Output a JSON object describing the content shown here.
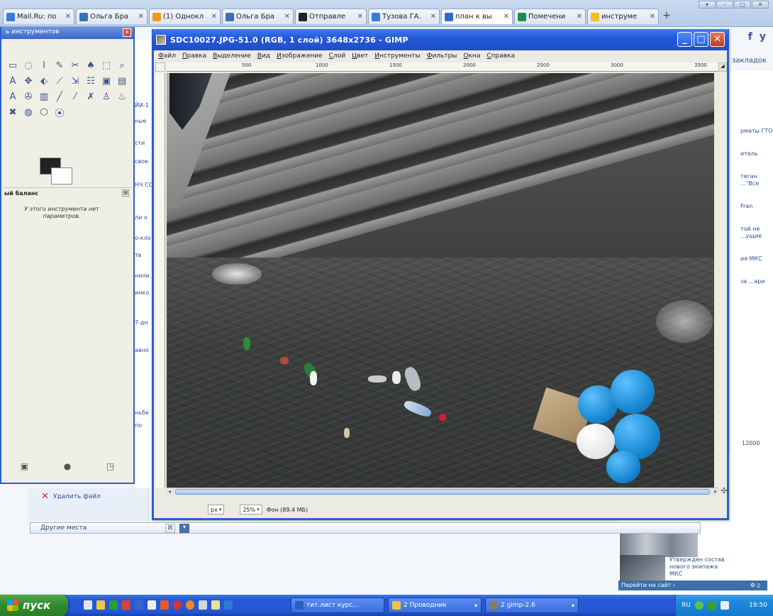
{
  "browser": {
    "tabs": [
      {
        "label": "Mail.Ru: по",
        "color": "#3a7ad8",
        "active": false
      },
      {
        "label": "Ольга Бра",
        "color": "#3b6fb6",
        "active": false
      },
      {
        "label": "(1) Однокл",
        "color": "#f29a1f",
        "active": false
      },
      {
        "label": "Ольга Бра",
        "color": "#3b6fb6",
        "active": false
      },
      {
        "label": "Отправле",
        "color": "#222222",
        "active": false
      },
      {
        "label": "Тузова ГА.",
        "color": "#3a7ad8",
        "active": false
      },
      {
        "label": "план к вы",
        "color": "#2f68c9",
        "active": true
      },
      {
        "label": "Помечени",
        "color": "#1e8f4a",
        "active": false
      },
      {
        "label": "инструме",
        "color": "#f2c01f",
        "active": false
      }
    ],
    "new_tab": "+",
    "window_controls": [
      "▾",
      "–",
      "□",
      "✕"
    ]
  },
  "background_page": {
    "social": [
      "f",
      "y"
    ],
    "bookmarks_link": "закладок",
    "right_snippets": [
      "рматы ГТО",
      "итель ",
      "теган ...\"Все",
      "Fran",
      "той не ...ущие",
      "ия МКС",
      "за ...ари"
    ],
    "right_number": "12000",
    "delete_file": "Удалить файл",
    "other_places": "Другие места",
    "widget_caption": "Утвержден состав нового экипажа МКС",
    "widget_bar": "Перейти на сайт ›",
    "mid_strip_items": [
      "ЙИ-1",
      "ные",
      "сти",
      "свое",
      "НЧ СС",
      "ли о",
      "о-кло",
      "тв",
      "нили",
      "инко",
      "7-дн",
      "авно",
      "ньбе",
      "по"
    ]
  },
  "toolbox": {
    "title": "ь инструментов",
    "close": "✕",
    "tools": [
      "▭",
      "◌",
      "⌇",
      "✎",
      "✂",
      "♠",
      "⬚",
      "⌕",
      "A",
      "✥",
      "⬖",
      "⟋",
      "⇲",
      "☷",
      "▣",
      "▤",
      "A",
      "✇",
      "▥",
      "╱",
      "⁄",
      "✗",
      "♙",
      "♨",
      "✖",
      "◍",
      "⬡",
      "⦿"
    ],
    "options_title": "ый баланс",
    "options_expand": "⊞",
    "options_text": "У этого инструмента нет параметров.",
    "bottom_buttons": [
      "▣",
      "●",
      "◳"
    ]
  },
  "gimp": {
    "title": "SDC10027.JPG-51.0 (RGB, 1 слой) 3648x2736 - GIMP",
    "menu": [
      "Файл",
      "Правка",
      "Выделение",
      "Вид",
      "Изображение",
      "Слой",
      "Цвет",
      "Инструменты",
      "Фильтры",
      "Окна",
      "Справка"
    ],
    "ruler_ticks": [
      "500",
      "1000",
      "1500",
      "2000",
      "2500",
      "3000",
      "3500"
    ],
    "status": {
      "unit": "px",
      "zoom": "25%",
      "text": "Фон (89.4 МБ)"
    },
    "window_controls": {
      "minimize": "_",
      "maximize": "□",
      "close": "✕"
    }
  },
  "taskbar": {
    "start_label": "пуск",
    "tasks": [
      {
        "label": "тит.лист курс...",
        "color": "#2b5fc0"
      },
      {
        "label": "2 Проводник",
        "color": "#f2c14a"
      },
      {
        "label": "2 gimp-2.6",
        "color": "#8a7a66"
      }
    ],
    "tray": {
      "lang": "RU",
      "clock": "19:50"
    }
  }
}
